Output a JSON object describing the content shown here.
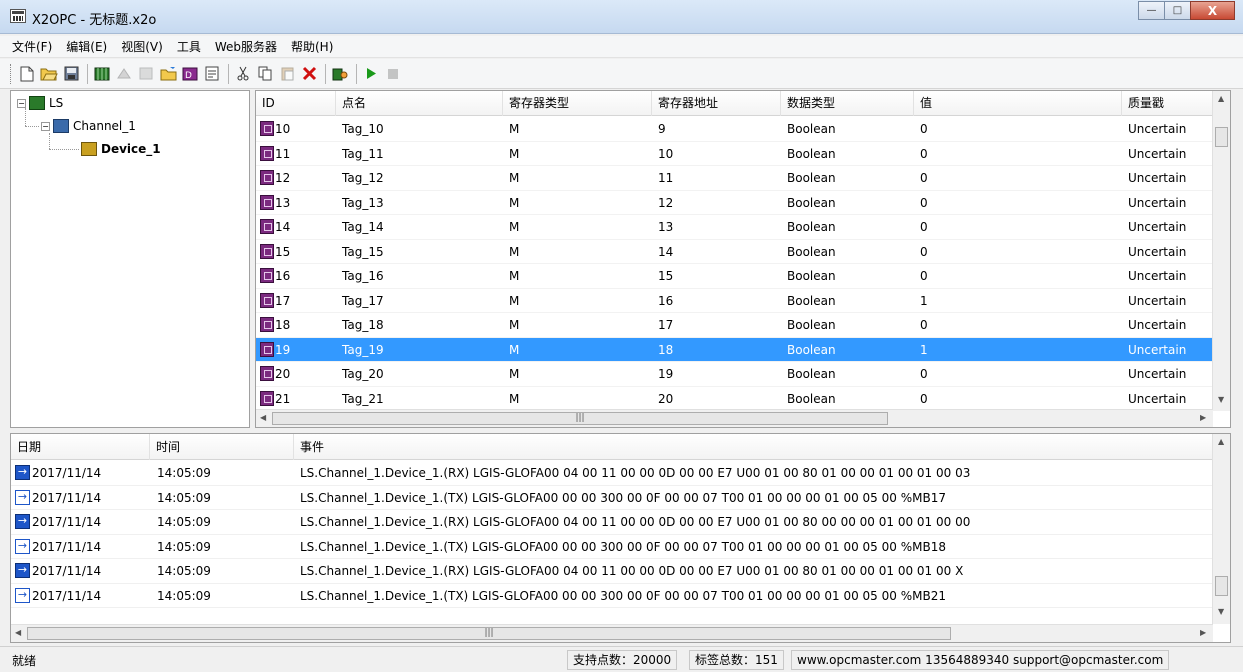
{
  "window": {
    "title": "X2OPC - 无标题.x2o",
    "min_label": "—",
    "max_label": "□",
    "close_label": "X"
  },
  "menu": [
    "文件(F)",
    "编辑(E)",
    "视图(V)",
    "工具",
    "Web服务器",
    "帮助(H)"
  ],
  "tree": {
    "root": "LS",
    "channel": "Channel_1",
    "device": "Device_1"
  },
  "tags": {
    "columns": [
      "ID",
      "点名",
      "寄存器类型",
      "寄存器地址",
      "数据类型",
      "值",
      "质量戳"
    ],
    "rows": [
      [
        "10",
        "Tag_10",
        "M",
        "9",
        "Boolean",
        "0",
        "Uncertain"
      ],
      [
        "11",
        "Tag_11",
        "M",
        "10",
        "Boolean",
        "0",
        "Uncertain"
      ],
      [
        "12",
        "Tag_12",
        "M",
        "11",
        "Boolean",
        "0",
        "Uncertain"
      ],
      [
        "13",
        "Tag_13",
        "M",
        "12",
        "Boolean",
        "0",
        "Uncertain"
      ],
      [
        "14",
        "Tag_14",
        "M",
        "13",
        "Boolean",
        "0",
        "Uncertain"
      ],
      [
        "15",
        "Tag_15",
        "M",
        "14",
        "Boolean",
        "0",
        "Uncertain"
      ],
      [
        "16",
        "Tag_16",
        "M",
        "15",
        "Boolean",
        "0",
        "Uncertain"
      ],
      [
        "17",
        "Tag_17",
        "M",
        "16",
        "Boolean",
        "1",
        "Uncertain"
      ],
      [
        "18",
        "Tag_18",
        "M",
        "17",
        "Boolean",
        "0",
        "Uncertain"
      ],
      [
        "19",
        "Tag_19",
        "M",
        "18",
        "Boolean",
        "1",
        "Uncertain"
      ],
      [
        "20",
        "Tag_20",
        "M",
        "19",
        "Boolean",
        "0",
        "Uncertain"
      ],
      [
        "21",
        "Tag_21",
        "M",
        "20",
        "Boolean",
        "0",
        "Uncertain"
      ]
    ],
    "selected_index": 9
  },
  "log": {
    "columns": [
      "日期",
      "时间",
      "事件"
    ],
    "rows": [
      [
        "2017/11/14",
        "14:05:09",
        "LS.Channel_1.Device_1.(RX) LGIS-GLOFA00 04 00 11 00 00 0D 00 00 E7 U00 01 00 80 01 00 00 01 00 01 00 03",
        "rx"
      ],
      [
        "2017/11/14",
        "14:05:09",
        "LS.Channel_1.Device_1.(TX) LGIS-GLOFA00 00 00 300 00 0F 00 00 07 T00 01 00 00 00 01 00 05 00 %MB17",
        "tx"
      ],
      [
        "2017/11/14",
        "14:05:09",
        "LS.Channel_1.Device_1.(RX) LGIS-GLOFA00 04 00 11 00 00 0D 00 00 E7 U00 01 00 80 00 00 00 01 00 01 00 00",
        "rx"
      ],
      [
        "2017/11/14",
        "14:05:09",
        "LS.Channel_1.Device_1.(TX) LGIS-GLOFA00 00 00 300 00 0F 00 00 07 T00 01 00 00 00 01 00 05 00 %MB18",
        "tx"
      ],
      [
        "2017/11/14",
        "14:05:09",
        "LS.Channel_1.Device_1.(RX) LGIS-GLOFA00 04 00 11 00 00 0D 00 00 E7 U00 01 00 80 01 00 00 01 00 01 00 X",
        "rx"
      ],
      [
        "2017/11/14",
        "14:05:09",
        "LS.Channel_1.Device_1.(TX) LGIS-GLOFA00 00 00 300 00 0F 00 00 07 T00 01 00 00 00 01 00 05 00 %MB21",
        "tx"
      ]
    ]
  },
  "status": {
    "ready": "就绪",
    "points": "支持点数：20000",
    "total_tags": "标签总数：151",
    "contact": "www.opcmaster.com 13564889340 support@opcmaster.com"
  },
  "colors": {
    "selection": "#3399ff",
    "tag_icon": "#7b2a7f",
    "log_icon": "#1e56c8"
  }
}
